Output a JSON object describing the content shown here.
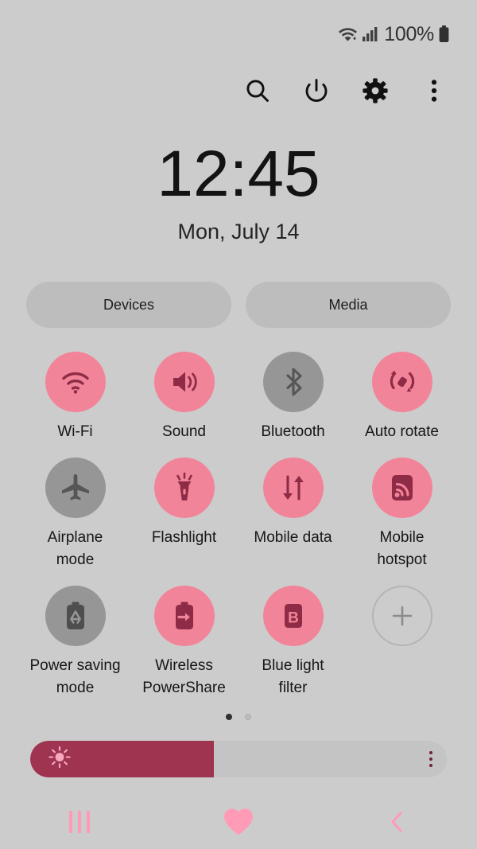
{
  "status_bar": {
    "wifi_icon": "wifi-data-icon",
    "signal_icon": "signal-bars-icon",
    "battery_percent": "100%",
    "battery_icon": "battery-full-icon"
  },
  "header": {
    "buttons": [
      {
        "name": "search-icon",
        "label": "Search"
      },
      {
        "name": "power-icon",
        "label": "Power"
      },
      {
        "name": "gear-icon",
        "label": "Settings"
      },
      {
        "name": "more-options-icon",
        "label": "More options"
      }
    ]
  },
  "clock": {
    "time": "12:45",
    "date": "Mon, July 14"
  },
  "pills": [
    {
      "label": "Devices"
    },
    {
      "label": "Media"
    }
  ],
  "toggles": [
    {
      "label": "Wi-Fi",
      "icon": "wifi-icon",
      "state": "on"
    },
    {
      "label": "Sound",
      "icon": "sound-icon",
      "state": "on"
    },
    {
      "label": "Bluetooth",
      "icon": "bluetooth-icon",
      "state": "off"
    },
    {
      "label": "Auto rotate",
      "icon": "auto-rotate-icon",
      "state": "on"
    },
    {
      "label": "Airplane mode",
      "icon": "airplane-icon",
      "state": "off"
    },
    {
      "label": "Flashlight",
      "icon": "flashlight-icon",
      "state": "on"
    },
    {
      "label": "Mobile data",
      "icon": "mobile-data-icon",
      "state": "on"
    },
    {
      "label": "Mobile hotspot",
      "icon": "mobile-hotspot-icon",
      "state": "on"
    },
    {
      "label": "Power saving mode",
      "icon": "power-saving-icon",
      "state": "off"
    },
    {
      "label": "Wireless PowerShare",
      "icon": "power-share-icon",
      "state": "on"
    },
    {
      "label": "Blue light filter",
      "icon": "blue-light-icon",
      "state": "on"
    },
    {
      "label": "",
      "icon": "plus-icon",
      "state": "add"
    }
  ],
  "page_indicator": {
    "total": 2,
    "active_index": 0
  },
  "brightness": {
    "value_percent": 44,
    "icon": "brightness-sun-icon",
    "menu_icon": "more-options-icon"
  },
  "nav_bar": [
    {
      "name": "recents-icon",
      "label": "Recents"
    },
    {
      "name": "home-heart-icon",
      "label": "Home"
    },
    {
      "name": "back-icon",
      "label": "Back"
    }
  ],
  "colors": {
    "background": "#cccccc",
    "accent_on": "#f28499",
    "accent_icon": "#8e2b46",
    "inactive": "#969696",
    "slider_fill": "#9e3450",
    "nav_pink": "#ff9bb7"
  }
}
